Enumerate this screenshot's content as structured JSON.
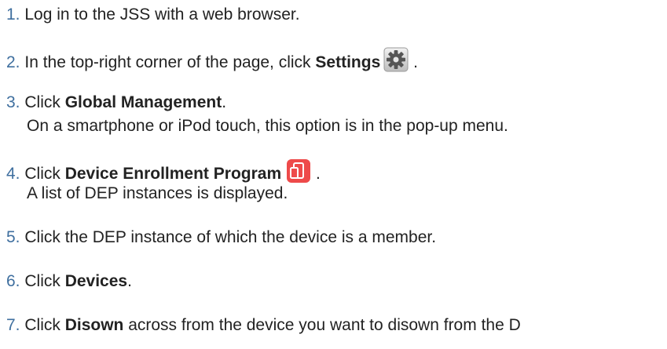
{
  "steps": [
    {
      "num": "1.",
      "text": "Log in to the JSS with a web browser."
    },
    {
      "num": "2.",
      "pre": "In the top-right corner of the page, click ",
      "bold": "Settings",
      "post": " ."
    },
    {
      "num": "3.",
      "pre": "Click ",
      "bold": "Global Management",
      "post": ".",
      "note": "On a smartphone or iPod touch, this option is in the pop-up menu."
    },
    {
      "num": "4.",
      "pre": "Click ",
      "bold": "Device Enrollment Program",
      "post": " .",
      "note": "A list of DEP instances is displayed."
    },
    {
      "num": "5.",
      "text": "Click the DEP instance of which the device is a member."
    },
    {
      "num": "6.",
      "pre": "Click ",
      "bold": "Devices",
      "post": "."
    },
    {
      "num": "7.",
      "pre": "Click ",
      "bold": "Disown",
      "post": " across from the device you want to disown from the D"
    }
  ],
  "icons": {
    "settings": "gear-icon",
    "dep": "device-enrollment-icon"
  },
  "colors": {
    "number": "#3f6f9f",
    "text": "#222222",
    "dep_icon": "#ee4a4a"
  }
}
